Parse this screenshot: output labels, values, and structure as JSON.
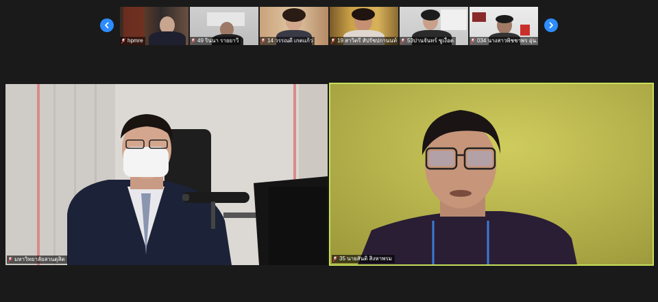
{
  "meeting": {
    "navigation": {
      "prev_icon": "chevron-left-icon",
      "next_icon": "chevron-right-icon",
      "accent": "#2d8cff"
    },
    "thumbnails": [
      {
        "name": "hpmre",
        "muted": true
      },
      {
        "name": "49 รินนา รายยาวี",
        "muted": true
      },
      {
        "name": "14 วรรณดี เกตแก้ว",
        "muted": true
      },
      {
        "name": "19 สาวิตรี สัปรัชปกานนท์",
        "muted": true
      },
      {
        "name": "53ปานจันทร์ ชูเงื่อต",
        "muted": true
      },
      {
        "name": "034 นางสาวพิชชาพร อุ่น...",
        "muted": true
      }
    ],
    "main_tiles": [
      {
        "name": "มหาวิทยาลัยสวนดุสิต",
        "muted": true,
        "active_speaker": false
      },
      {
        "name": "35 นายสันติ สิงหาพรม",
        "muted": true,
        "active_speaker": true
      }
    ],
    "active_speaker_color": "#c7e05a",
    "mic_muted_color": "#e5484d"
  }
}
